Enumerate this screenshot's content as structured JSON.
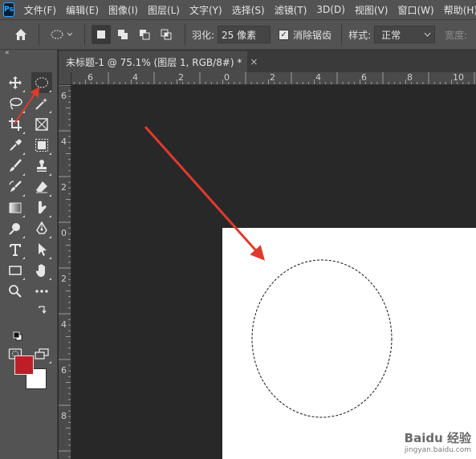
{
  "app": {
    "logo_text": "Ps"
  },
  "menu": {
    "items": [
      "文件(F)",
      "编辑(E)",
      "图像(I)",
      "图层(L)",
      "文字(Y)",
      "选择(S)",
      "滤镜(T)",
      "3D(D)",
      "视图(V)",
      "窗口(W)",
      "帮助(H)"
    ]
  },
  "options": {
    "feather_label": "羽化:",
    "feather_value": "25 像素",
    "antialias_label": "消除锯齿",
    "antialias_checked": true,
    "style_label": "样式:",
    "style_value": "正常",
    "width_label": "宽度:"
  },
  "toolbar": {
    "collapse": "«",
    "foreground_color": "#be1e28",
    "background_color": "#ffffff"
  },
  "document": {
    "tab_title": "未标题-1 @ 75.1% (图层 1, RGB/8#) *",
    "close_glyph": "×"
  },
  "rulers": {
    "horizontal": [
      "6",
      "4",
      "2",
      "0",
      "2",
      "4",
      "6",
      "8",
      "10"
    ],
    "vertical": [
      "6",
      "4",
      "2",
      "0",
      "2",
      "4",
      "6",
      "8"
    ]
  },
  "watermark": {
    "brand": "Baidu 经验",
    "url": "jingyan.baidu.com"
  }
}
